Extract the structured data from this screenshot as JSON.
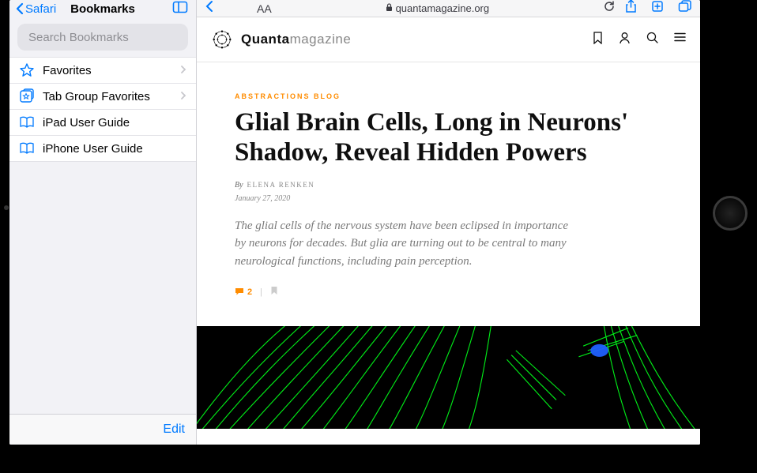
{
  "sidebar": {
    "back_label": "Safari",
    "title": "Bookmarks",
    "search_placeholder": "Search Bookmarks",
    "items": [
      {
        "label": "Favorites",
        "icon": "star",
        "chevron": true
      },
      {
        "label": "Tab Group Favorites",
        "icon": "tabstar",
        "chevron": true
      },
      {
        "label": "iPad User Guide",
        "icon": "book",
        "chevron": false
      },
      {
        "label": "iPhone User Guide",
        "icon": "book",
        "chevron": false
      }
    ],
    "edit_label": "Edit"
  },
  "browser": {
    "aa_label": "AA",
    "url_text": "quantamagazine.org"
  },
  "site": {
    "logo_bold": "Quanta",
    "logo_thin": "magazine"
  },
  "article": {
    "category": "ABSTRACTIONS BLOG",
    "title": "Glial Brain Cells, Long in Neurons' Shadow, Reveal Hidden Powers",
    "by_prefix": "By",
    "author": "ELENA RENKEN",
    "date": "January 27, 2020",
    "lede": "The glial cells of the nervous system have been eclipsed in importance by neurons for decades. But glia are turning out to be central to many neurological functions, including pain perception.",
    "comment_count": "2"
  }
}
